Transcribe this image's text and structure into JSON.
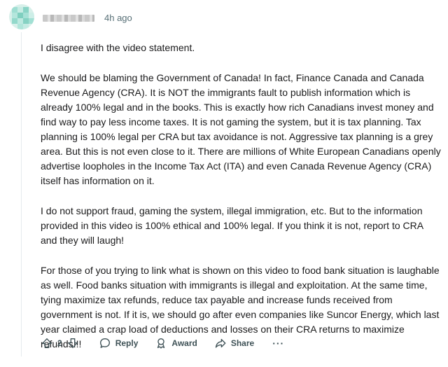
{
  "comment": {
    "username": "",
    "timestamp": "4h ago",
    "paragraphs": [
      "I disagree with the video statement.",
      "We should be blaming the Government of Canada! In fact, Finance Canada and Canada Revenue Agency (CRA). It is NOT the immigrants fault to publish information which is already 100% legal and in the books. This is exactly how rich Canadians invest money and find way to pay less income taxes. It is not gaming the system, but it is tax planning. Tax planning is 100% legal per CRA but tax avoidance is not. Aggressive tax planning is a grey area. But this is not even close to it. There are millions of White European Canadians openly advertise loopholes in the Income Tax Act (ITA) and even Canada Revenue Agency (CRA) itself has information on it.",
      "I do not support fraud, gaming the system, illegal immigration, etc. But to the information provided in this video is 100% ethical and 100% legal. If you think it is not, report to CRA and they will laugh!",
      "For those of you trying to link what is shown on this video to food bank situation is laughable as well. Food banks situation with immigrants is illegal and exploitation. At the same time, tying maximize tax refunds, reduce tax payable and increase funds received from government is not. If it is, we should go after even companies like Suncor Energy, which last year claimed a crap load of deductions and losses on their CRA returns to maximize refunds!!!"
    ]
  },
  "actions": {
    "vote_count": "2",
    "reply_label": "Reply",
    "award_label": "Award",
    "share_label": "Share",
    "more_label": "···"
  },
  "icons": {
    "upvote": "arrow-up-icon",
    "downvote": "arrow-down-icon",
    "reply": "speech-bubble-icon",
    "award": "award-ribbon-icon",
    "share": "share-arrow-icon",
    "more": "ellipsis-icon"
  },
  "colors": {
    "text": "#1a1a1b",
    "meta": "#576f76",
    "action": "#3e5156",
    "avatar_bg": "#d8f0ea"
  }
}
